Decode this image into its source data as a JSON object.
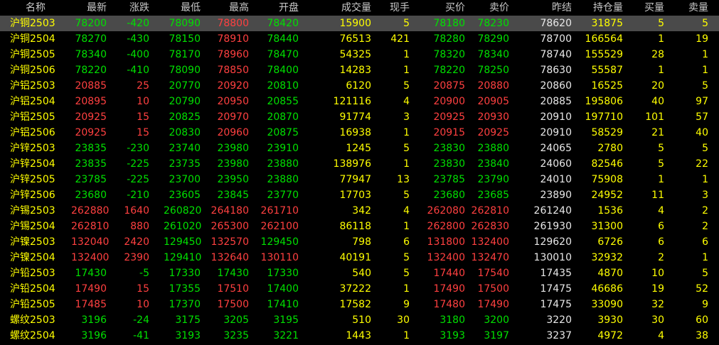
{
  "colors": {
    "name": "#ffff00",
    "up": "#ff4040",
    "down": "#00e000",
    "neutral": "#e8e8e8",
    "volume": "#ffff00",
    "selected_row_bg": "#4a4a4a"
  },
  "columns": [
    {
      "key": "name",
      "label": "名称"
    },
    {
      "key": "last",
      "label": "最新"
    },
    {
      "key": "chg",
      "label": "涨跌"
    },
    {
      "key": "low",
      "label": "最低"
    },
    {
      "key": "high",
      "label": "最高"
    },
    {
      "key": "open",
      "label": "开盘"
    },
    {
      "key": "vol",
      "label": "成交量"
    },
    {
      "key": "cur",
      "label": "现手"
    },
    {
      "key": "bid",
      "label": "买价"
    },
    {
      "key": "ask",
      "label": "卖价"
    },
    {
      "key": "prev",
      "label": "昨结"
    },
    {
      "key": "oi",
      "label": "持仓量"
    },
    {
      "key": "bq",
      "label": "买量"
    },
    {
      "key": "aq",
      "label": "卖量"
    }
  ],
  "rows": [
    {
      "name": "沪铜2503",
      "last": "78200",
      "chg": "-420",
      "low": "78090",
      "high": "78800",
      "open": "78420",
      "vol": "15900",
      "cur": "5",
      "bid": "78180",
      "ask": "78230",
      "prev": "78620",
      "oi": "31875",
      "bq": "5",
      "aq": "5",
      "selected": true
    },
    {
      "name": "沪铜2504",
      "last": "78270",
      "chg": "-430",
      "low": "78150",
      "high": "78910",
      "open": "78440",
      "vol": "76513",
      "cur": "421",
      "bid": "78280",
      "ask": "78290",
      "prev": "78700",
      "oi": "166564",
      "bq": "1",
      "aq": "19"
    },
    {
      "name": "沪铜2505",
      "last": "78340",
      "chg": "-400",
      "low": "78170",
      "high": "78960",
      "open": "78470",
      "vol": "54325",
      "cur": "1",
      "bid": "78320",
      "ask": "78340",
      "prev": "78740",
      "oi": "155529",
      "bq": "28",
      "aq": "1"
    },
    {
      "name": "沪铜2506",
      "last": "78220",
      "chg": "-410",
      "low": "78090",
      "high": "78850",
      "open": "78400",
      "vol": "14283",
      "cur": "1",
      "bid": "78220",
      "ask": "78250",
      "prev": "78630",
      "oi": "55587",
      "bq": "1",
      "aq": "1"
    },
    {
      "name": "沪铝2503",
      "last": "20885",
      "chg": "25",
      "low": "20770",
      "high": "20920",
      "open": "20810",
      "vol": "6120",
      "cur": "5",
      "bid": "20875",
      "ask": "20880",
      "prev": "20860",
      "oi": "16525",
      "bq": "20",
      "aq": "5"
    },
    {
      "name": "沪铝2504",
      "last": "20895",
      "chg": "10",
      "low": "20790",
      "high": "20950",
      "open": "20855",
      "vol": "121116",
      "cur": "4",
      "bid": "20900",
      "ask": "20905",
      "prev": "20885",
      "oi": "195806",
      "bq": "40",
      "aq": "97"
    },
    {
      "name": "沪铝2505",
      "last": "20925",
      "chg": "15",
      "low": "20825",
      "high": "20970",
      "open": "20870",
      "vol": "91774",
      "cur": "3",
      "bid": "20925",
      "ask": "20930",
      "prev": "20910",
      "oi": "197710",
      "bq": "101",
      "aq": "57"
    },
    {
      "name": "沪铝2506",
      "last": "20925",
      "chg": "15",
      "low": "20830",
      "high": "20960",
      "open": "20875",
      "vol": "16938",
      "cur": "1",
      "bid": "20915",
      "ask": "20925",
      "prev": "20910",
      "oi": "58529",
      "bq": "21",
      "aq": "40"
    },
    {
      "name": "沪锌2503",
      "last": "23835",
      "chg": "-230",
      "low": "23740",
      "high": "23980",
      "open": "23910",
      "vol": "1245",
      "cur": "5",
      "bid": "23830",
      "ask": "23880",
      "prev": "24065",
      "oi": "2780",
      "bq": "5",
      "aq": "5"
    },
    {
      "name": "沪锌2504",
      "last": "23835",
      "chg": "-225",
      "low": "23735",
      "high": "23980",
      "open": "23880",
      "vol": "138976",
      "cur": "1",
      "bid": "23830",
      "ask": "23840",
      "prev": "24060",
      "oi": "82546",
      "bq": "5",
      "aq": "22"
    },
    {
      "name": "沪锌2505",
      "last": "23785",
      "chg": "-225",
      "low": "23700",
      "high": "23950",
      "open": "23880",
      "vol": "77947",
      "cur": "13",
      "bid": "23785",
      "ask": "23790",
      "prev": "24010",
      "oi": "75908",
      "bq": "1",
      "aq": "1"
    },
    {
      "name": "沪锌2506",
      "last": "23680",
      "chg": "-210",
      "low": "23605",
      "high": "23845",
      "open": "23770",
      "vol": "17703",
      "cur": "5",
      "bid": "23680",
      "ask": "23685",
      "prev": "23890",
      "oi": "24952",
      "bq": "11",
      "aq": "3"
    },
    {
      "name": "沪锡2503",
      "last": "262880",
      "chg": "1640",
      "low": "260820",
      "high": "264180",
      "open": "261710",
      "vol": "342",
      "cur": "4",
      "bid": "262080",
      "ask": "262810",
      "prev": "261240",
      "oi": "1536",
      "bq": "4",
      "aq": "2"
    },
    {
      "name": "沪锡2504",
      "last": "262810",
      "chg": "880",
      "low": "261020",
      "high": "265300",
      "open": "262100",
      "vol": "86118",
      "cur": "1",
      "bid": "262800",
      "ask": "262830",
      "prev": "261930",
      "oi": "31300",
      "bq": "6",
      "aq": "2"
    },
    {
      "name": "沪镍2503",
      "last": "132040",
      "chg": "2420",
      "low": "129450",
      "high": "132570",
      "open": "129450",
      "vol": "798",
      "cur": "6",
      "bid": "131800",
      "ask": "132400",
      "prev": "129620",
      "oi": "6726",
      "bq": "6",
      "aq": "6"
    },
    {
      "name": "沪镍2504",
      "last": "132400",
      "chg": "2390",
      "low": "129410",
      "high": "132640",
      "open": "130110",
      "vol": "40191",
      "cur": "5",
      "bid": "132400",
      "ask": "132470",
      "prev": "130010",
      "oi": "32932",
      "bq": "2",
      "aq": "1"
    },
    {
      "name": "沪铅2503",
      "last": "17430",
      "chg": "-5",
      "low": "17330",
      "high": "17430",
      "open": "17330",
      "vol": "540",
      "cur": "5",
      "bid": "17440",
      "ask": "17540",
      "prev": "17435",
      "oi": "4870",
      "bq": "10",
      "aq": "5"
    },
    {
      "name": "沪铅2504",
      "last": "17490",
      "chg": "15",
      "low": "17355",
      "high": "17510",
      "open": "17400",
      "vol": "37222",
      "cur": "1",
      "bid": "17490",
      "ask": "17500",
      "prev": "17475",
      "oi": "46686",
      "bq": "19",
      "aq": "52"
    },
    {
      "name": "沪铅2505",
      "last": "17485",
      "chg": "10",
      "low": "17370",
      "high": "17500",
      "open": "17410",
      "vol": "17582",
      "cur": "9",
      "bid": "17480",
      "ask": "17490",
      "prev": "17475",
      "oi": "33090",
      "bq": "32",
      "aq": "9"
    },
    {
      "name": "螺纹2503",
      "last": "3196",
      "chg": "-24",
      "low": "3175",
      "high": "3205",
      "open": "3195",
      "vol": "510",
      "cur": "30",
      "bid": "3180",
      "ask": "3200",
      "prev": "3220",
      "oi": "3930",
      "bq": "30",
      "aq": "60"
    },
    {
      "name": "螺纹2504",
      "last": "3196",
      "chg": "-41",
      "low": "3193",
      "high": "3235",
      "open": "3221",
      "vol": "1443",
      "cur": "1",
      "bid": "3193",
      "ask": "3197",
      "prev": "3237",
      "oi": "4972",
      "bq": "4",
      "aq": "38"
    }
  ]
}
